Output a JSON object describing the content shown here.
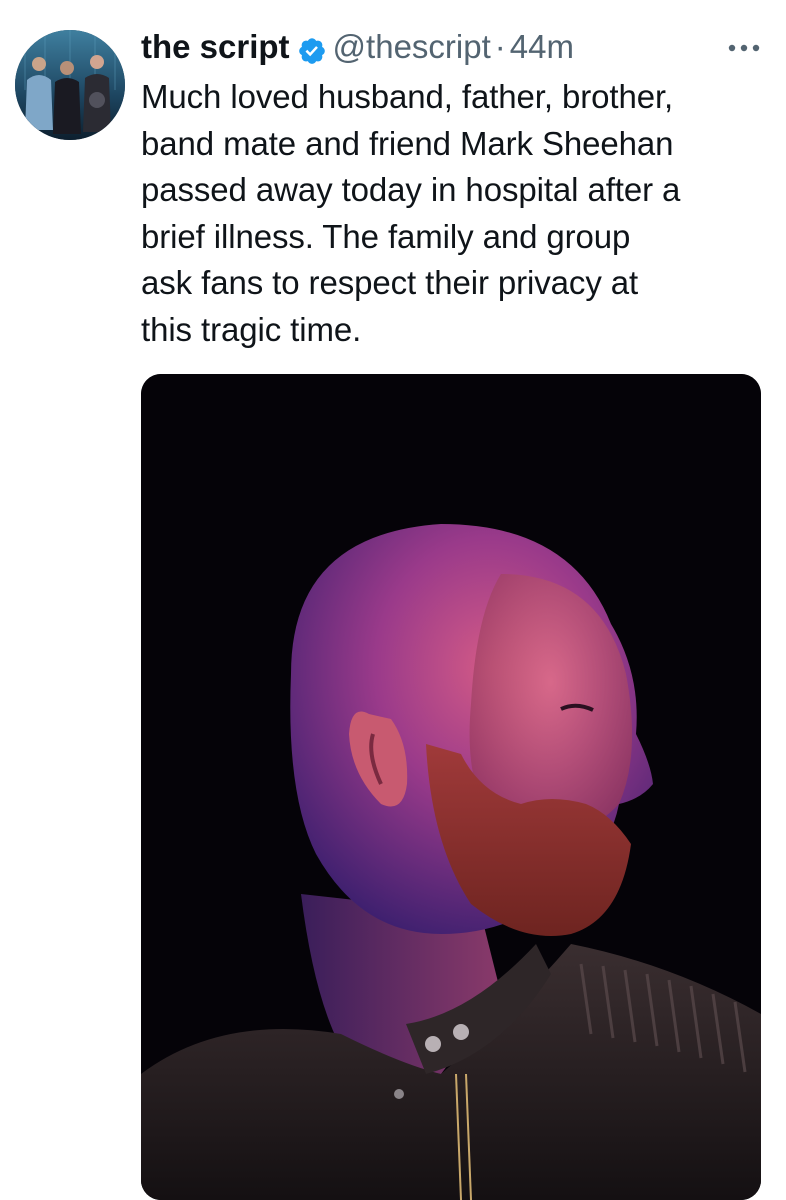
{
  "tweet": {
    "author": {
      "display_name": "the script",
      "handle": "@thescript",
      "verified": true,
      "avatar_icon": "band-avatar"
    },
    "separator": "·",
    "timestamp": "44m",
    "more_icon": "more-horizontal-icon",
    "text": "Much loved husband, father, brother,\nband mate and friend Mark Sheehan\npassed away today in hospital after a\nbrief illness.  The family and group\nask fans to respect their privacy at\nthis tragic time.",
    "media": {
      "kind": "photo",
      "subject": "bald-bearded-man-profile-photo"
    }
  },
  "colors": {
    "text_primary": "#0f1419",
    "text_secondary": "#536471",
    "verified_badge": "#1d9bf0",
    "media_background": "#050308"
  }
}
